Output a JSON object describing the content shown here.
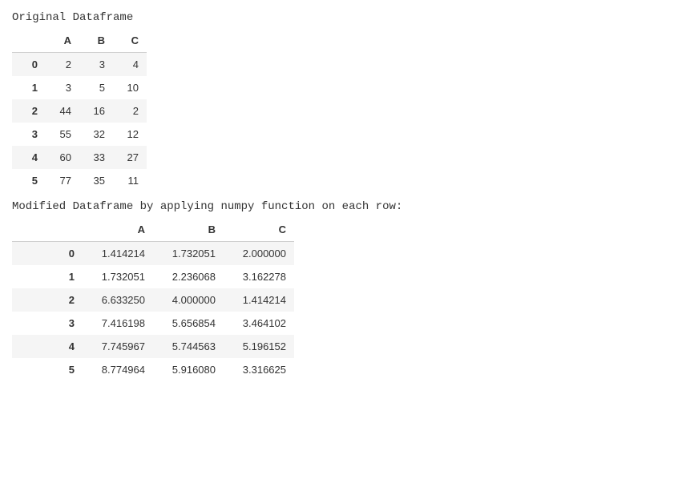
{
  "captions": {
    "original": "Original Dataframe",
    "modified": "Modified Dataframe by applying numpy function on each row:"
  },
  "original": {
    "columns": {
      "blank": "",
      "A": "A",
      "B": "B",
      "C": "C"
    },
    "rows": [
      {
        "idx": "0",
        "A": "2",
        "B": "3",
        "C": "4"
      },
      {
        "idx": "1",
        "A": "3",
        "B": "5",
        "C": "10"
      },
      {
        "idx": "2",
        "A": "44",
        "B": "16",
        "C": "2"
      },
      {
        "idx": "3",
        "A": "55",
        "B": "32",
        "C": "12"
      },
      {
        "idx": "4",
        "A": "60",
        "B": "33",
        "C": "27"
      },
      {
        "idx": "5",
        "A": "77",
        "B": "35",
        "C": "11"
      }
    ]
  },
  "modified": {
    "columns": {
      "blank": "",
      "A": "A",
      "B": "B",
      "C": "C"
    },
    "rows": [
      {
        "idx": "0",
        "A": "1.414214",
        "B": "1.732051",
        "C": "2.000000"
      },
      {
        "idx": "1",
        "A": "1.732051",
        "B": "2.236068",
        "C": "3.162278"
      },
      {
        "idx": "2",
        "A": "6.633250",
        "B": "4.000000",
        "C": "1.414214"
      },
      {
        "idx": "3",
        "A": "7.416198",
        "B": "5.656854",
        "C": "3.464102"
      },
      {
        "idx": "4",
        "A": "7.745967",
        "B": "5.744563",
        "C": "5.196152"
      },
      {
        "idx": "5",
        "A": "8.774964",
        "B": "5.916080",
        "C": "3.316625"
      }
    ]
  },
  "chart_data": [
    {
      "type": "table",
      "title": "Original Dataframe",
      "columns": [
        "A",
        "B",
        "C"
      ],
      "index": [
        0,
        1,
        2,
        3,
        4,
        5
      ],
      "data": [
        [
          2,
          3,
          4
        ],
        [
          3,
          5,
          10
        ],
        [
          44,
          16,
          2
        ],
        [
          55,
          32,
          12
        ],
        [
          60,
          33,
          27
        ],
        [
          77,
          35,
          11
        ]
      ]
    },
    {
      "type": "table",
      "title": "Modified Dataframe by applying numpy function on each row:",
      "columns": [
        "A",
        "B",
        "C"
      ],
      "index": [
        0,
        1,
        2,
        3,
        4,
        5
      ],
      "data": [
        [
          1.414214,
          1.732051,
          2.0
        ],
        [
          1.732051,
          2.236068,
          3.162278
        ],
        [
          6.63325,
          4.0,
          1.414214
        ],
        [
          7.416198,
          5.656854,
          3.464102
        ],
        [
          7.745967,
          5.744563,
          5.196152
        ],
        [
          8.774964,
          5.91608,
          3.316625
        ]
      ]
    }
  ]
}
